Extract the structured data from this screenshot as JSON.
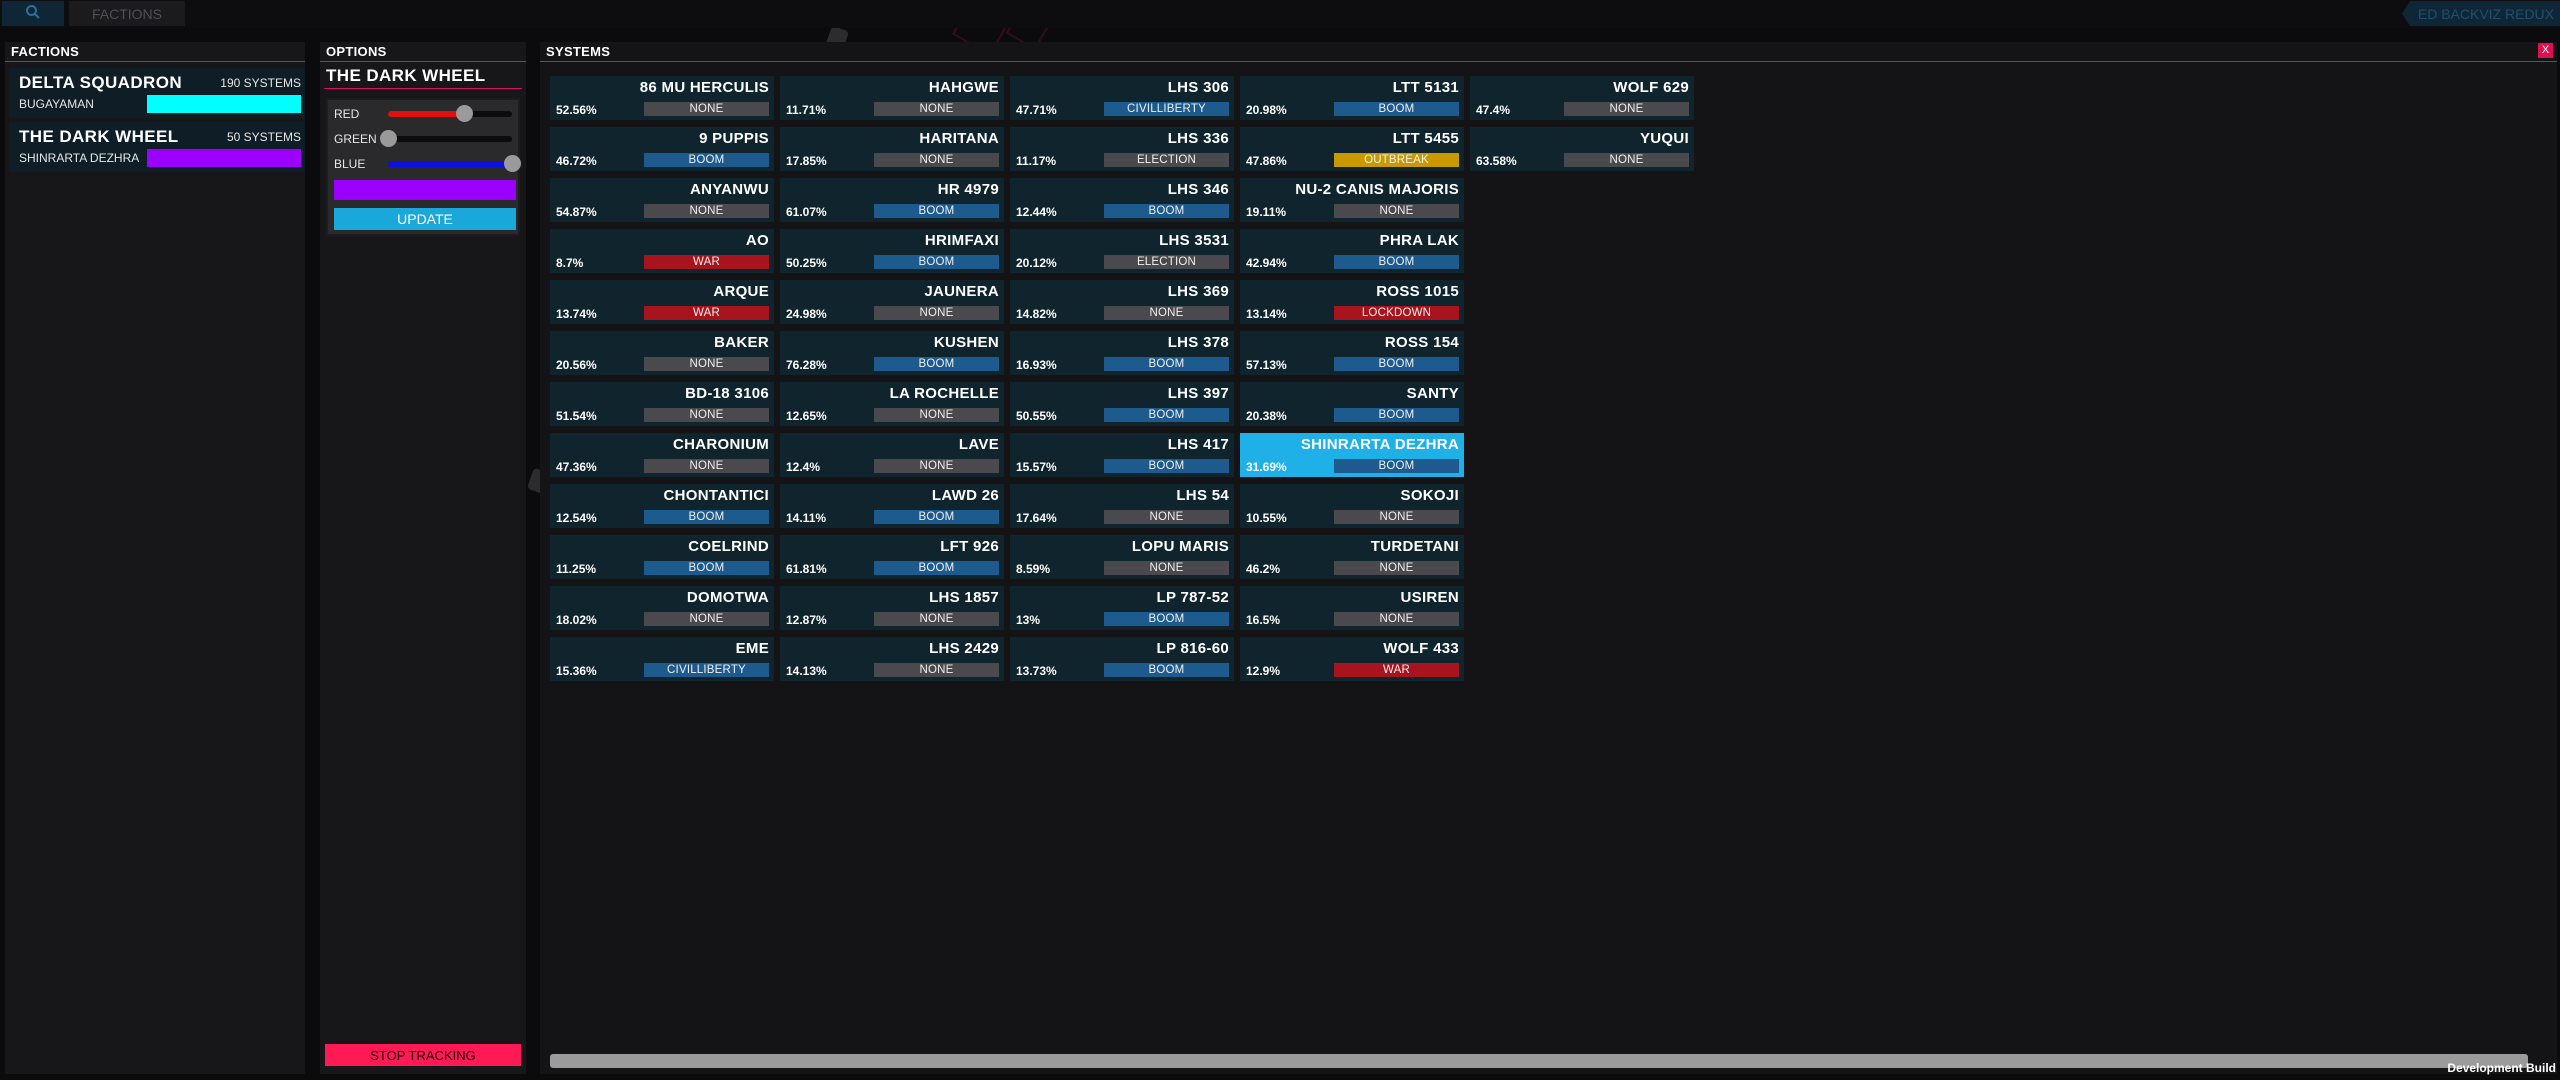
{
  "topbar": {
    "search_icon": "search-icon",
    "factions_label": "FACTIONS",
    "app_title": "ED BACKVIZ REDUX"
  },
  "factions_panel": {
    "header": "FACTIONS",
    "factions": [
      {
        "name": "DELTA SQUADRON",
        "count": "190 SYSTEMS",
        "system": "BUGAYAMAN",
        "color": "#00ffff"
      },
      {
        "name": "THE DARK WHEEL",
        "count": "50 SYSTEMS",
        "system": "SHINRARTA DEZHRA",
        "color": "#9b00ff"
      }
    ]
  },
  "options_panel": {
    "header": "OPTIONS",
    "title": "THE DARK WHEEL",
    "sliders": [
      {
        "label": "RED",
        "value": 0.61,
        "color": "#e01010"
      },
      {
        "label": "GREEN",
        "value": 0.0,
        "color": "#1a9a1a"
      },
      {
        "label": "BLUE",
        "value": 1.0,
        "color": "#1010e0"
      }
    ],
    "preview_color": "#9b00ff",
    "update_label": "UPDATE",
    "stop_label": "STOP TRACKING"
  },
  "systems_panel": {
    "header": "SYSTEMS",
    "close_label": "X",
    "dev_build": "Development Build",
    "state_colors": {
      "NONE": "#4a4a4e",
      "BOOM": "#1d5a8e",
      "CIVILLIBERTY": "#1d5a8e",
      "ELECTION": "#4a4a4e",
      "WAR": "#a8141e",
      "LOCKDOWN": "#a8141e",
      "OUTBREAK": "#c99a00"
    },
    "columns": [
      [
        {
          "name": "86 MU HERCULIS",
          "pct": "52.56%",
          "state": "NONE"
        },
        {
          "name": "9 PUPPIS",
          "pct": "46.72%",
          "state": "BOOM"
        },
        {
          "name": "ANYANWU",
          "pct": "54.87%",
          "state": "NONE"
        },
        {
          "name": "AO",
          "pct": "8.7%",
          "state": "WAR"
        },
        {
          "name": "ARQUE",
          "pct": "13.74%",
          "state": "WAR"
        },
        {
          "name": "BAKER",
          "pct": "20.56%",
          "state": "NONE"
        },
        {
          "name": "BD-18 3106",
          "pct": "51.54%",
          "state": "NONE"
        },
        {
          "name": "CHARONIUM",
          "pct": "47.36%",
          "state": "NONE"
        },
        {
          "name": "CHONTANTICI",
          "pct": "12.54%",
          "state": "BOOM"
        },
        {
          "name": "COELRIND",
          "pct": "11.25%",
          "state": "BOOM"
        },
        {
          "name": "DOMOTWA",
          "pct": "18.02%",
          "state": "NONE"
        },
        {
          "name": "EME",
          "pct": "15.36%",
          "state": "CIVILLIBERTY"
        }
      ],
      [
        {
          "name": "HAHGWE",
          "pct": "11.71%",
          "state": "NONE"
        },
        {
          "name": "HARITANA",
          "pct": "17.85%",
          "state": "NONE"
        },
        {
          "name": "HR 4979",
          "pct": "61.07%",
          "state": "BOOM"
        },
        {
          "name": "HRIMFAXI",
          "pct": "50.25%",
          "state": "BOOM"
        },
        {
          "name": "JAUNERA",
          "pct": "24.98%",
          "state": "NONE"
        },
        {
          "name": "KUSHEN",
          "pct": "76.28%",
          "state": "BOOM"
        },
        {
          "name": "LA ROCHELLE",
          "pct": "12.65%",
          "state": "NONE"
        },
        {
          "name": "LAVE",
          "pct": "12.4%",
          "state": "NONE"
        },
        {
          "name": "LAWD 26",
          "pct": "14.11%",
          "state": "BOOM"
        },
        {
          "name": "LFT 926",
          "pct": "61.81%",
          "state": "BOOM"
        },
        {
          "name": "LHS 1857",
          "pct": "12.87%",
          "state": "NONE"
        },
        {
          "name": "LHS 2429",
          "pct": "14.13%",
          "state": "NONE"
        }
      ],
      [
        {
          "name": "LHS 306",
          "pct": "47.71%",
          "state": "CIVILLIBERTY"
        },
        {
          "name": "LHS 336",
          "pct": "11.17%",
          "state": "ELECTION"
        },
        {
          "name": "LHS 346",
          "pct": "12.44%",
          "state": "BOOM"
        },
        {
          "name": "LHS 3531",
          "pct": "20.12%",
          "state": "ELECTION"
        },
        {
          "name": "LHS 369",
          "pct": "14.82%",
          "state": "NONE"
        },
        {
          "name": "LHS 378",
          "pct": "16.93%",
          "state": "BOOM"
        },
        {
          "name": "LHS 397",
          "pct": "50.55%",
          "state": "BOOM"
        },
        {
          "name": "LHS 417",
          "pct": "15.57%",
          "state": "BOOM"
        },
        {
          "name": "LHS 54",
          "pct": "17.64%",
          "state": "NONE"
        },
        {
          "name": "LOPU MARIS",
          "pct": "8.59%",
          "state": "NONE"
        },
        {
          "name": "LP 787-52",
          "pct": "13%",
          "state": "BOOM"
        },
        {
          "name": "LP 816-60",
          "pct": "13.73%",
          "state": "BOOM"
        }
      ],
      [
        {
          "name": "LTT 5131",
          "pct": "20.98%",
          "state": "BOOM"
        },
        {
          "name": "LTT 5455",
          "pct": "47.86%",
          "state": "OUTBREAK"
        },
        {
          "name": "NU-2 CANIS MAJORIS",
          "pct": "19.11%",
          "state": "NONE"
        },
        {
          "name": "PHRA LAK",
          "pct": "42.94%",
          "state": "BOOM"
        },
        {
          "name": "ROSS 1015",
          "pct": "13.14%",
          "state": "LOCKDOWN"
        },
        {
          "name": "ROSS 154",
          "pct": "57.13%",
          "state": "BOOM"
        },
        {
          "name": "SANTY",
          "pct": "20.38%",
          "state": "BOOM"
        },
        {
          "name": "SHINRARTA DEZHRA",
          "pct": "31.69%",
          "state": "BOOM",
          "selected": true
        },
        {
          "name": "SOKOJI",
          "pct": "10.55%",
          "state": "NONE"
        },
        {
          "name": "TURDETANI",
          "pct": "46.2%",
          "state": "NONE"
        },
        {
          "name": "USIREN",
          "pct": "16.5%",
          "state": "NONE"
        },
        {
          "name": "WOLF 433",
          "pct": "12.9%",
          "state": "WAR"
        }
      ],
      [
        {
          "name": "WOLF 629",
          "pct": "47.4%",
          "state": "NONE"
        },
        {
          "name": "YUQUI",
          "pct": "63.58%",
          "state": "NONE"
        }
      ]
    ]
  }
}
